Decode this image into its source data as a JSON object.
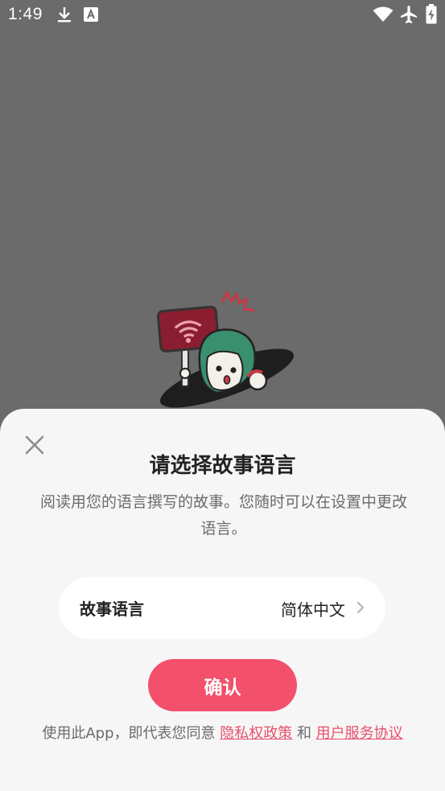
{
  "status_bar": {
    "time": "1:49",
    "icons": [
      "download-icon",
      "a-notification-icon",
      "wifi-icon",
      "airplane-mode-icon",
      "battery-charging-icon"
    ]
  },
  "illustration": {
    "name": "mascot-no-wifi-sign"
  },
  "dialog": {
    "close_icon": "close-icon",
    "title": "请选择故事语言",
    "description": "阅读用您的语言撰写的故事。您随时可以在设置中更改语言。",
    "language_row": {
      "label": "故事语言",
      "value": "简体中文",
      "chevron_icon": "chevron-right-icon"
    },
    "confirm_label": "确认",
    "footer": {
      "prefix": "使用此App，即代表您同意 ",
      "privacy_link": "隐私权政策",
      "connector": " 和 ",
      "terms_link": "用户服务协议"
    }
  },
  "colors": {
    "overlay": "#6b6b6b",
    "sheet_bg": "#f6f6f6",
    "accent": "#f2506b",
    "link": "#e8506a"
  }
}
